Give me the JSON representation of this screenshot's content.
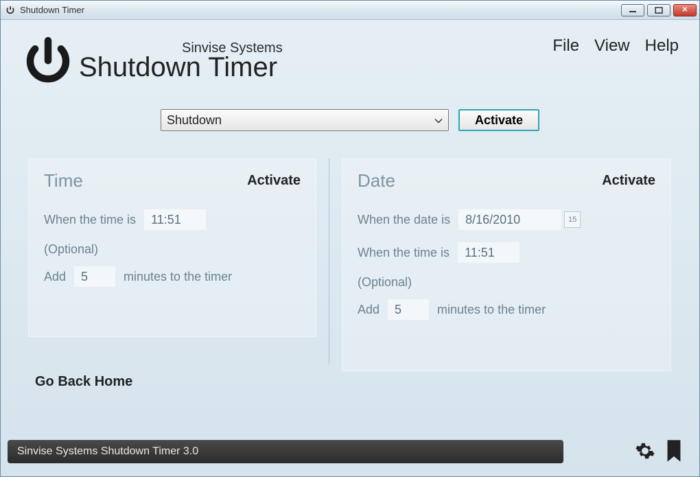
{
  "window": {
    "title": "Shutdown Timer"
  },
  "header": {
    "company": "Sinvise Systems",
    "app_title": "Shutdown Timer"
  },
  "menu": {
    "file": "File",
    "view": "View",
    "help": "Help"
  },
  "action": {
    "selected": "Shutdown",
    "activate_label": "Activate"
  },
  "time_panel": {
    "title": "Time",
    "activate": "Activate",
    "when_label": "When the time is",
    "time_value": "11:51",
    "optional_label": "(Optional)",
    "add_label": "Add",
    "add_value": "5",
    "add_suffix": "minutes to the timer"
  },
  "date_panel": {
    "title": "Date",
    "activate": "Activate",
    "when_date_label": "When the date is",
    "date_value": "8/16/2010",
    "cal_day": "15",
    "when_time_label": "When the time is",
    "time_value": "11:51",
    "optional_label": "(Optional)",
    "add_label": "Add",
    "add_value": "5",
    "add_suffix": "minutes to the timer"
  },
  "go_back": "Go Back Home",
  "status": "Sinvise Systems Shutdown Timer 3.0"
}
